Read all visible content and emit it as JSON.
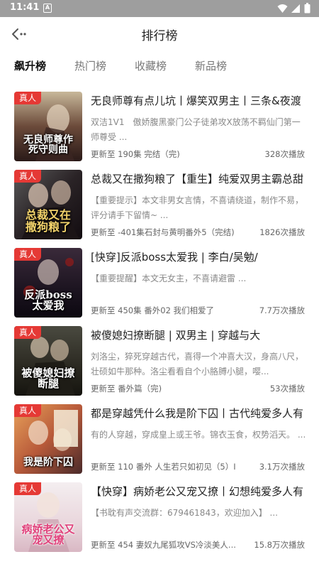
{
  "status_bar": {
    "time": "11:41",
    "notification_letter": "A"
  },
  "header": {
    "title": "排行榜"
  },
  "tabs": [
    {
      "label": "飙升榜",
      "active": true
    },
    {
      "label": "热门榜",
      "active": false
    },
    {
      "label": "收藏榜",
      "active": false
    },
    {
      "label": "新品榜",
      "active": false
    }
  ],
  "books": [
    {
      "tag": "真人",
      "cover_text": "无良师尊作死守则曲",
      "title": "无良师尊有点儿坑丨爆笑双男主丨三条&夜渡",
      "desc": "双洁1V1　傲娇腹黑豪门公子徒弟攻X放荡不羁仙门第一师尊受 ...",
      "meta": "更新至  190集 完结（完)",
      "plays": "328次播放"
    },
    {
      "tag": "真人",
      "cover_text": "总裁又在撒狗粮了",
      "title": "总裁又在撒狗粮了【重生】纯爱双男主霸总甜",
      "desc": "【重要提示】本文非男女言情，不喜请绕道，制作不易，评分请手下留情~ ...",
      "meta": "更新至  -401集石封与黄明番外5（完结)",
      "plays": "1826次播放"
    },
    {
      "tag": "真人",
      "cover_text": "反派boss太爱我",
      "title": "[快穿]反派boss太爱我 | 李白/吴勉/",
      "desc": "【重要提醒】本文无女主，不喜请避雷 ...",
      "meta": "更新至  450集 番外02 我们相爱了",
      "plays": "7.7万次播放"
    },
    {
      "tag": "真人",
      "cover_text": "被傻媳妇撩断腿",
      "title": "被傻媳妇撩断腿 | 双男主 | 穿越与大",
      "desc": "刘洛尘，猝死穿越古代，喜得一个冲喜大汉，身高八尺，壮硕如牛那种。洛尘看看自个小胳膊小腿，嘤...",
      "meta": "更新至  番外篇（完)",
      "plays": "53次播放"
    },
    {
      "tag": "真人",
      "cover_text": "我是阶下囚",
      "title": "都是穿越凭什么我是阶下囚丨古代纯爱多人有",
      "desc": "有的人穿越，穿成皇上或王爷。锦衣玉食，权势滔天。 ...",
      "meta": "更新至  110 番外 人生若只如初见（5）I",
      "plays": "3.1万次播放"
    },
    {
      "tag": "真人",
      "cover_text": "病娇老公又宠又撩",
      "title": "【快穿】病娇老公又宠又撩丨幻想纯爱多人有",
      "desc": "【书耽有声交流群：679461843，欢迎加入】 ...",
      "meta": "更新至  454 妻奴九尾狐攻VS冷淡美人...",
      "plays": "15.8万次播放"
    }
  ],
  "colors": {
    "tag_bg": "#e53935",
    "status_bar_bg": "#9e9e9e"
  },
  "icons": {
    "back": "back-arrow-icon",
    "wifi": "wifi-icon",
    "signal": "signal-icon",
    "battery": "battery-icon"
  }
}
